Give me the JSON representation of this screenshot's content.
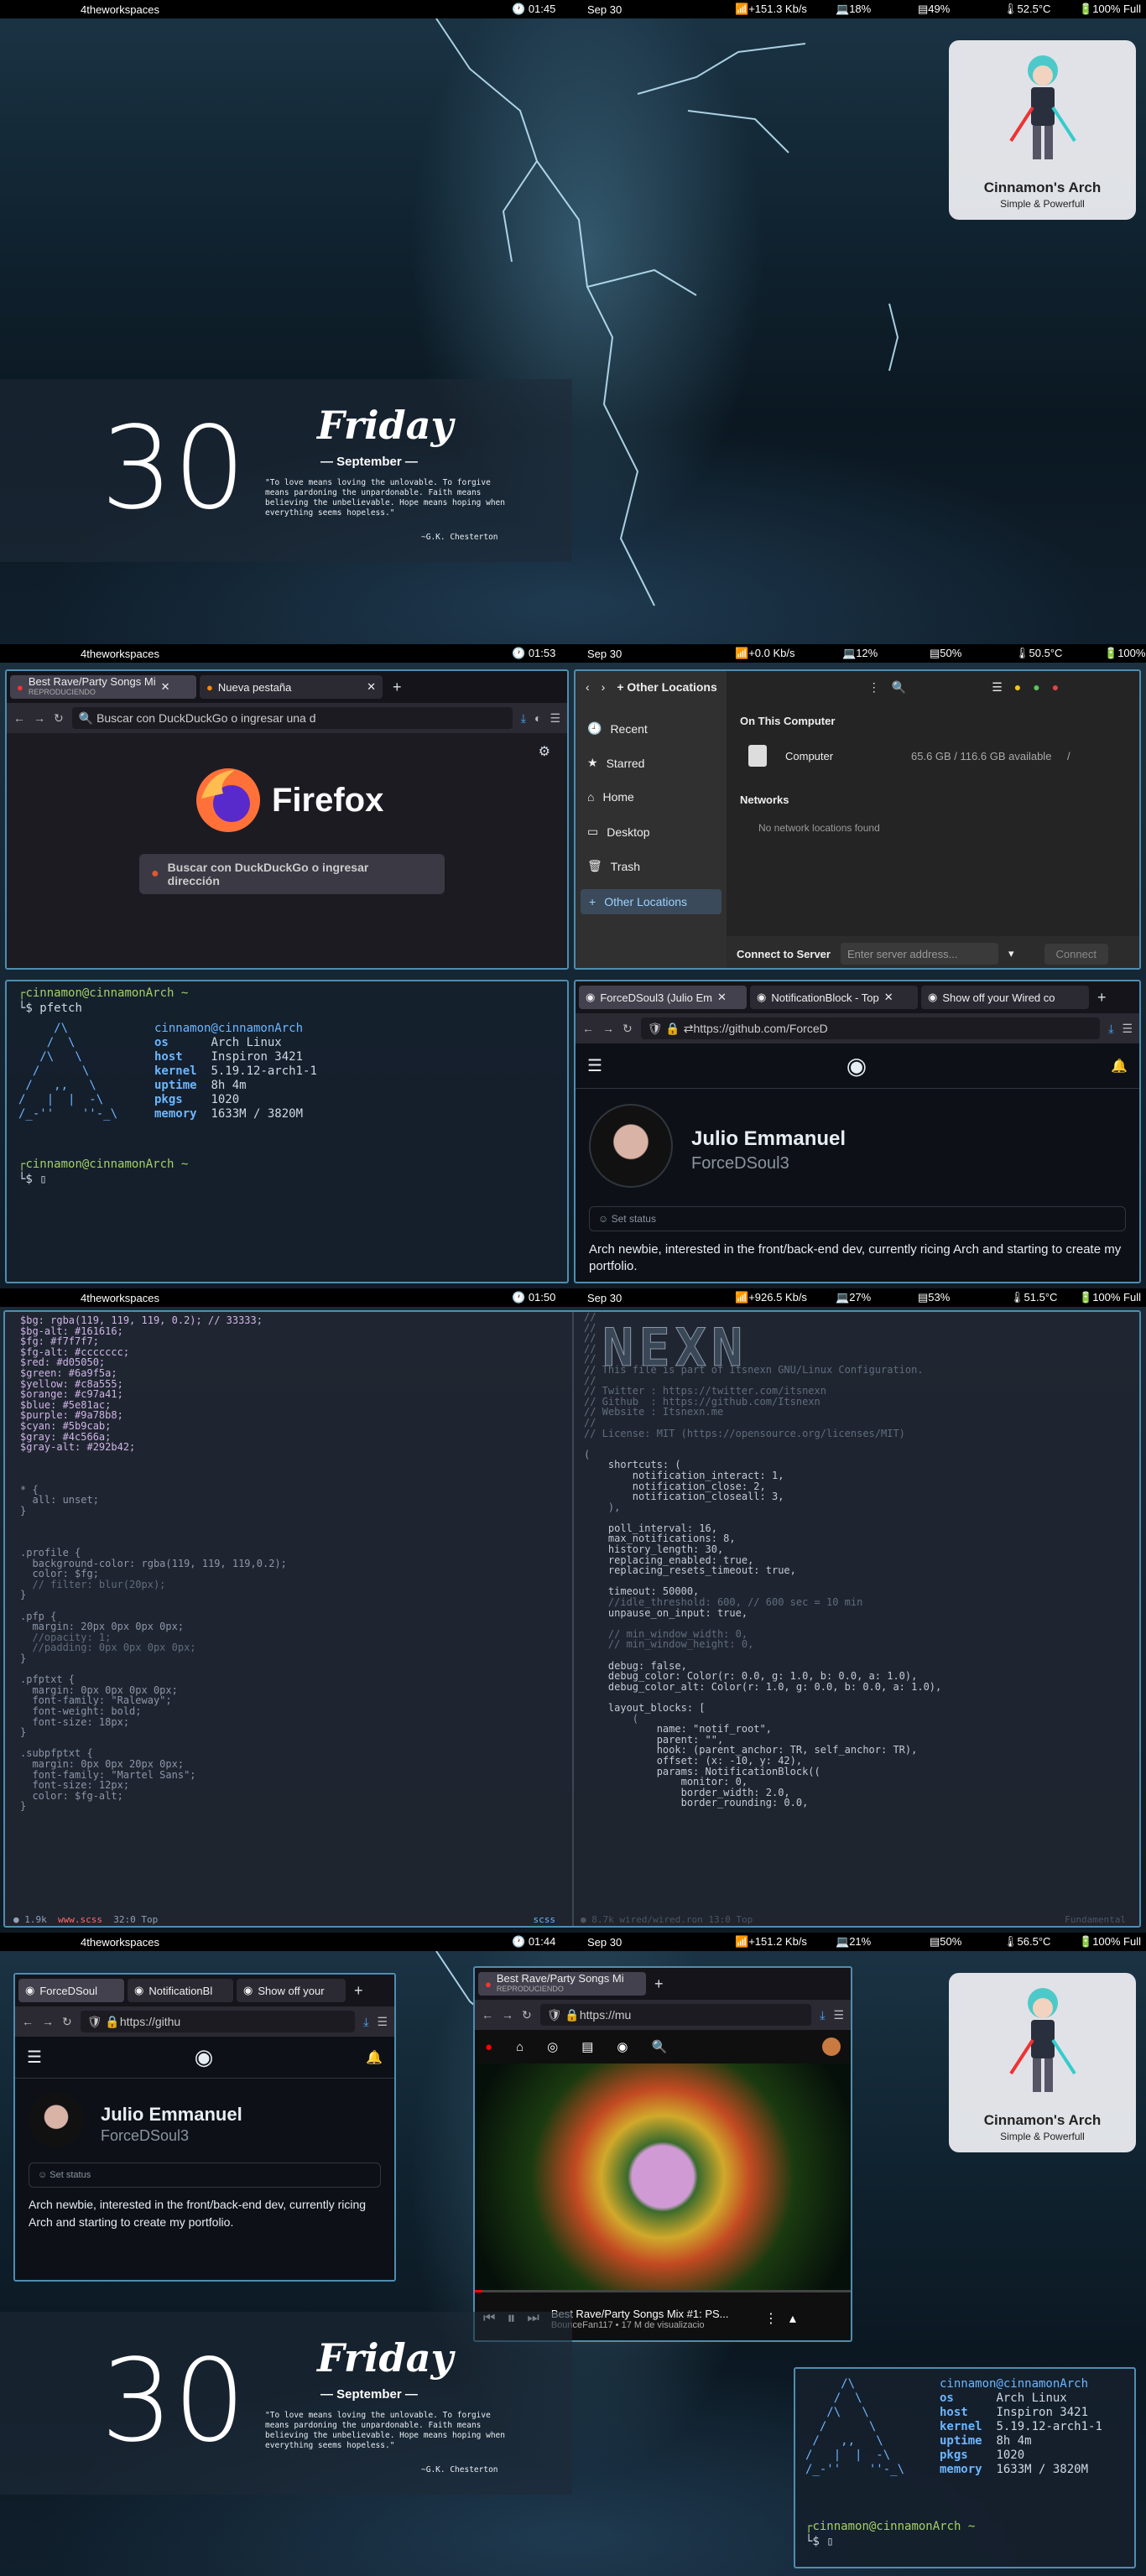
{
  "workspace_label": "4theworkspaces",
  "panels": [
    {
      "clock": "01:45",
      "date": "Sep 30",
      "net": "+151.3 Kb/s",
      "cpu": "18%",
      "ram": "49%",
      "temp": "52.5°C",
      "battery": "100% Full"
    },
    {
      "clock": "01:53",
      "date": "Sep 30",
      "net": "+0.0 Kb/s",
      "cpu": "12%",
      "ram": "50%",
      "temp": "50.5°C",
      "battery": "100%"
    },
    {
      "clock": "01:50",
      "date": "Sep 30",
      "net": "+926.5 Kb/s",
      "cpu": "27%",
      "ram": "53%",
      "temp": "51.5°C",
      "battery": "100% Full"
    },
    {
      "clock": "01:44",
      "date": "Sep 30",
      "net": "+151.2 Kb/s",
      "cpu": "21%",
      "ram": "50%",
      "temp": "56.5°C",
      "battery": "100% Full"
    }
  ],
  "date_widget": {
    "day": "30",
    "weekday": "Friday",
    "month": "— September —",
    "quote": "\"To love means loving the unlovable. To forgive means pardoning the unpardonable. Faith means believing the unbelievable. Hope means hoping when everything seems hopeless.\"",
    "author": "~G.K. Chesterton"
  },
  "profile": {
    "name": "Cinnamon's Arch",
    "subtitle": "Simple & Powerfull"
  },
  "firefox1": {
    "tab1": "Best Rave/Party Songs Mi",
    "tab1_sub": "REPRODUCIENDO",
    "tab2": "Nueva pestaña",
    "url_placeholder": "Buscar con DuckDuckGo o ingresar una d",
    "brand": "Firefox",
    "search_hint": "Buscar con DuckDuckGo o ingresar dirección"
  },
  "files": {
    "location": "Other Locations",
    "sidebar": [
      "Recent",
      "Starred",
      "Home",
      "Desktop",
      "Trash",
      "Other Locations"
    ],
    "section_computer": "On This Computer",
    "computer": "Computer",
    "computer_space": "65.6 GB / 116.6 GB available",
    "computer_path": "/",
    "section_networks": "Networks",
    "no_networks": "No network locations found",
    "connect_label": "Connect to Server",
    "connect_placeholder": "Enter server address...",
    "connect_button": "Connect"
  },
  "terminal": {
    "prompt": "cinnamon@cinnamonArch ~",
    "cmd": "pfetch",
    "userhost": "cinnamon@cinnamonArch",
    "rows": [
      [
        "os",
        "Arch Linux"
      ],
      [
        "host",
        "Inspiron 3421"
      ],
      [
        "kernel",
        "5.19.12-arch1-1"
      ],
      [
        "uptime",
        "8h 4m"
      ],
      [
        "pkgs",
        "1020"
      ],
      [
        "memory",
        "1633M / 3820M"
      ]
    ],
    "logo": [
      "     /\\",
      "    /  \\",
      "   /\\   \\",
      "  /      \\",
      " /   ,,   \\",
      "/   |  |  -\\",
      "/_-''    ''-_\\"
    ]
  },
  "github": {
    "tab1": "ForceDSoul3 (Julio Em",
    "tab2": "NotificationBlock - Top",
    "tab3": "Show off your Wired co",
    "url": "https://github.com/ForceD",
    "name": "Julio Emmanuel",
    "login": "ForceDSoul3",
    "status": "Set status",
    "bio": "Arch newbie, interested in the front/back-end dev, currently ricing Arch and starting to create my portfolio."
  },
  "github_small": {
    "tab1": "ForceDSoul",
    "tab2": "NotificationBl",
    "tab3": "Show off your",
    "url": "https://githu",
    "bio": "Arch newbie, interested in the front/back-end dev, currently ricing Arch and starting to create my portfolio."
  },
  "youtube": {
    "tab1": "Best Rave/Party Songs Mi",
    "tab1_sub": "REPRODUCIENDO",
    "url": "https://mu",
    "title": "Best Rave/Party Songs Mix #1: PS...",
    "channel": "BounceFan117 • 17 M de visualizacio"
  },
  "editor_left": {
    "status_pos": "1.9k",
    "status_file": "www.scss",
    "status_cursor": "32:0 Top",
    "status_lang": "scss",
    "lines": [
      "$bg: rgba(119, 119, 119, 0.2); // 33333;",
      "$bg-alt: #161616;",
      "$fg: #f7f7f7;",
      "$fg-alt: #ccccccc;",
      "$red: #d05050;",
      "$green: #6a9f5a;",
      "$yellow: #c8a555;",
      "$orange: #c97a41;",
      "$blue: #5e81ac;",
      "$purple: #9a78b8;",
      "$cyan: #5b9cab;",
      "$gray: #4c566a;",
      "$gray-alt: #292b42;",
      "",
      "",
      "",
      "* {",
      "  all: unset;",
      "}",
      "",
      "",
      "",
      ".profile {",
      "  background-color: rgba(119, 119, 119,0.2);",
      "  color: $fg;",
      "  // filter: blur(20px);",
      "}",
      "",
      ".pfp {",
      "  margin: 20px 0px 0px 0px;",
      "  //opacity: 1;",
      "  //padding: 0px 0px 0px 0px;",
      "}",
      "",
      ".pfptxt {",
      "  margin: 0px 0px 0px 0px;",
      "  font-family: \"Raleway\";",
      "  font-weight: bold;",
      "  font-size: 18px;",
      "}",
      "",
      ".subpfptxt {",
      "  margin: 0px 0px 20px 0px;",
      "  font-family: \"Martel Sans\";",
      "  font-size: 12px;",
      "  color: $fg-alt;",
      "}",
      "",
      ""
    ]
  },
  "editor_right": {
    "status": "8.7k  wired/wired.ron  13:0 Top",
    "status_lang": "Fundamental",
    "banner": "NEXN",
    "lines": [
      "//",
      "//",
      "//",
      "//",
      "//",
      "// This file is part of Itsnexn GNU/Linux Configuration.",
      "//",
      "// Twitter : https://twitter.com/itsnexn",
      "// Github  : https://github.com/Itsnexn",
      "// Website : Itsnexn.me",
      "//",
      "// License: MIT (https://opensource.org/licenses/MIT)",
      "",
      "(",
      "    shortcuts: (",
      "        notification_interact: 1,",
      "        notification_close: 2,",
      "        notification_closeall: 3,",
      "    ),",
      "",
      "    poll_interval: 16,",
      "    max_notifications: 8,",
      "    history_length: 30,",
      "    replacing_enabled: true,",
      "    replacing_resets_timeout: true,",
      "",
      "    timeout: 50000,",
      "    //idle_threshold: 600, // 600 sec = 10 min",
      "    unpause_on_input: true,",
      "",
      "    // min_window_width: 0,",
      "    // min_window_height: 0,",
      "",
      "    debug: false,",
      "    debug_color: Color(r: 0.0, g: 1.0, b: 0.0, a: 1.0),",
      "    debug_color_alt: Color(r: 1.0, g: 0.0, b: 0.0, a: 1.0),",
      "",
      "    layout_blocks: [",
      "        (",
      "            name: \"notif_root\",",
      "            parent: \"\",",
      "            hook: (parent_anchor: TR, self_anchor: TR),",
      "            offset: (x: -10, y: 42),",
      "            params: NotificationBlock((",
      "                monitor: 0,",
      "                border_width: 2.0,",
      "                border_rounding: 0.0,"
    ]
  },
  "colors": {
    "border": "#4f8db0",
    "green": "#a3d067",
    "blue": "#6cb6ff"
  }
}
